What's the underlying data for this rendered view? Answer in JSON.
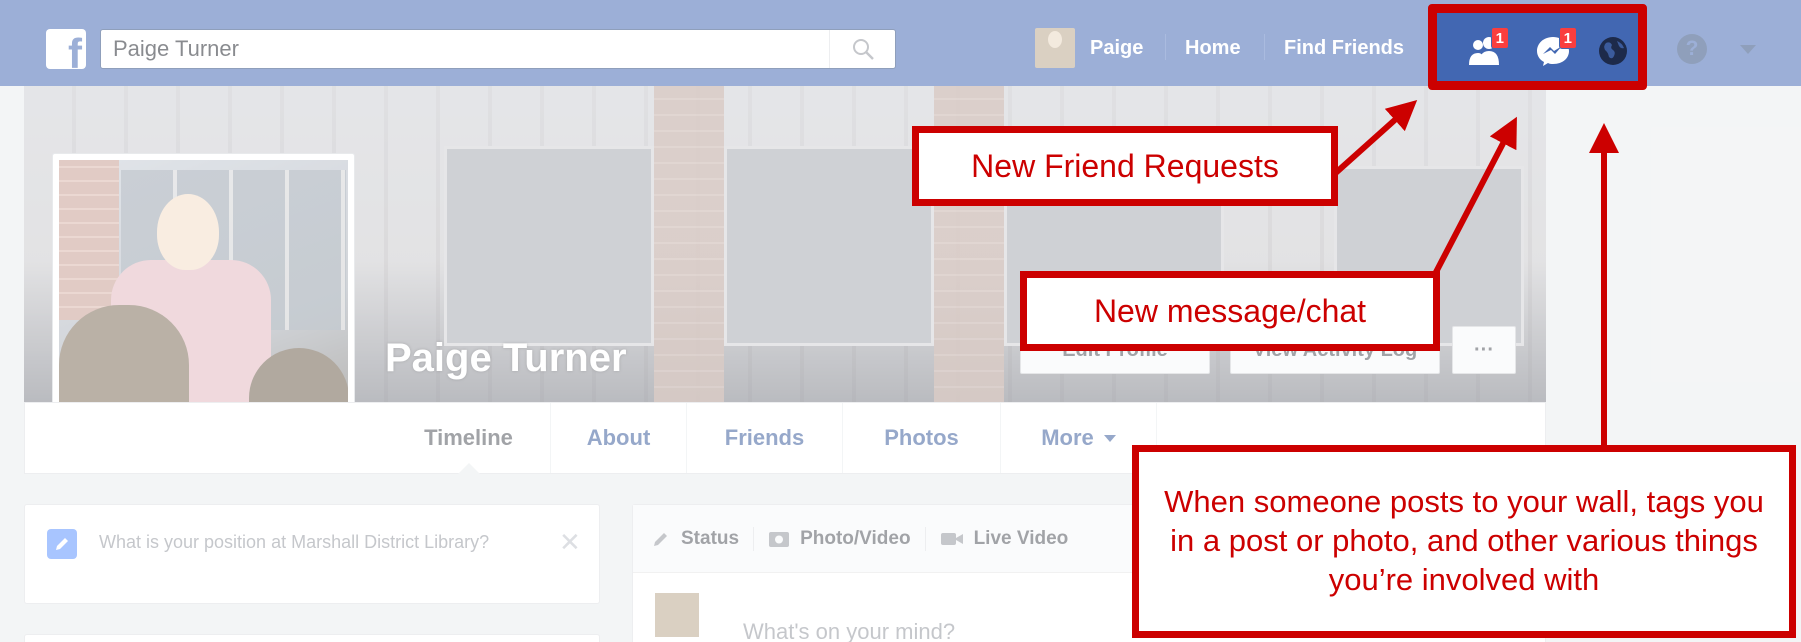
{
  "topbar": {
    "search_value": "Paige Turner",
    "profile_link": "Paige",
    "home_link": "Home",
    "find_friends_link": "Find Friends",
    "friend_requests_badge": "1",
    "messages_badge": "1",
    "help_glyph": "?",
    "brand_color": "#4267b2",
    "icons": [
      "facebook-logo-icon",
      "search-icon",
      "friend-requests-icon",
      "messenger-icon",
      "notifications-globe-icon",
      "help-icon",
      "account-caret-icon"
    ]
  },
  "profile": {
    "name": "Paige Turner",
    "edit_profile_button": "Edit Profile",
    "activity_log_button": "View Activity Log",
    "more_options_button": "···",
    "tabs": [
      {
        "label": "Timeline",
        "active": true
      },
      {
        "label": "About"
      },
      {
        "label": "Friends"
      },
      {
        "label": "Photos"
      },
      {
        "label": "More"
      }
    ]
  },
  "sidebar_prompt": {
    "text": "What is your position at Marshall District Library?",
    "close_glyph": "✕"
  },
  "composer": {
    "tabs": [
      "Status",
      "Photo/Video",
      "Live Video"
    ],
    "placeholder": "What's on your mind?"
  },
  "annotations": {
    "friend_requests": "New Friend Requests",
    "messages": "New message/chat",
    "notifications": "When someone posts to your wall, tags you in a post or photo, and other various things you’re involved with",
    "annotation_color": "#cc0000"
  }
}
